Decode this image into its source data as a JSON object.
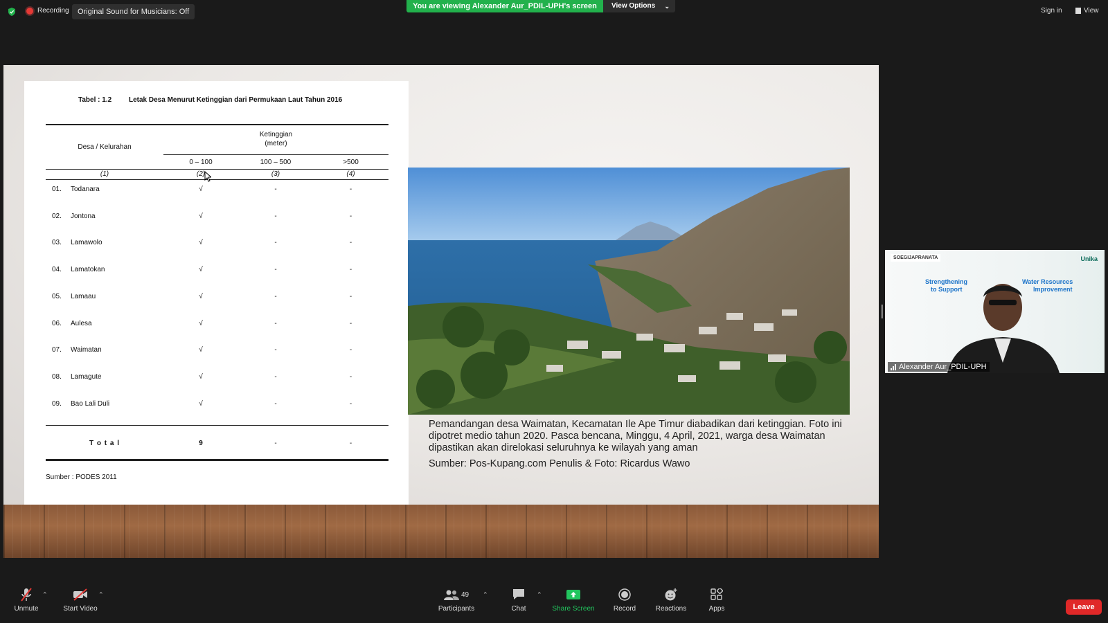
{
  "topbar": {
    "recording_label": "Recording",
    "original_sound": "Original Sound for Musicians: Off",
    "viewing_banner": "You are viewing Alexander Aur_PDIL-UPH's screen",
    "view_options": "View Options",
    "sign_in": "Sign in",
    "view": "View"
  },
  "slide": {
    "table": {
      "title_num": "Tabel :  1.2",
      "title_text": "Letak Desa Menurut Ketinggian dari Permukaan Laut Tahun 2016",
      "col_desa": "Desa / Kelurahan",
      "col_ketinggian": "Ketinggian",
      "col_meter": "(meter)",
      "sub_headers": [
        "0 – 100",
        "100 – 500",
        ">500"
      ],
      "col_numbers": [
        "(1)",
        "(2)",
        "(3)",
        "(4)"
      ],
      "rows": [
        {
          "no": "01.",
          "name": "Todanara",
          "c1": "√",
          "c2": "-",
          "c3": "-"
        },
        {
          "no": "02.",
          "name": "Jontona",
          "c1": "√",
          "c2": "-",
          "c3": "-"
        },
        {
          "no": "03.",
          "name": "Lamawolo",
          "c1": "√",
          "c2": "-",
          "c3": "-"
        },
        {
          "no": "04.",
          "name": "Lamatokan",
          "c1": "√",
          "c2": "-",
          "c3": "-"
        },
        {
          "no": "05.",
          "name": "Lamaau",
          "c1": "√",
          "c2": "-",
          "c3": "-"
        },
        {
          "no": "06.",
          "name": "Aulesa",
          "c1": "√",
          "c2": "-",
          "c3": "-"
        },
        {
          "no": "07.",
          "name": "Waimatan",
          "c1": "√",
          "c2": "-",
          "c3": "-"
        },
        {
          "no": "08.",
          "name": "Lamagute",
          "c1": "√",
          "c2": "-",
          "c3": "-"
        },
        {
          "no": "09.",
          "name": "Bao Lali Duli",
          "c1": "√",
          "c2": "-",
          "c3": "-"
        }
      ],
      "total_label": "T o t a l",
      "total_values": [
        "9",
        "-",
        "-"
      ],
      "source": "Sumber  : PODES 2011"
    },
    "caption": "Pemandangan desa Waimatan, Kecamatan Ile Ape Timur diabadikan dari ketinggian. Foto ini dipotret medio tahun 2020. Pasca bencana, Minggu, 4 April, 2021, warga desa Waimatan dipastikan akan direlokasi seluruhnya ke wilayah yang aman",
    "source_prefix": "Sumber: ",
    "source_link": "Pos-Kupang.com",
    "source_suffix": " Penulis & Foto: Ricardus Wawo"
  },
  "participant": {
    "name": "Alexander Aur_PDIL-UPH",
    "bg_logo_left": "SOEGIJAPRANATA",
    "bg_logo_right": "Unika",
    "bg_line1": "Strengthening",
    "bg_line1b": "Water Resources",
    "bg_line2": "to Support",
    "bg_line2b": "Improvement"
  },
  "toolbar": {
    "unmute": "Unmute",
    "start_video": "Start Video",
    "participants": "Participants",
    "participant_count": "49",
    "chat": "Chat",
    "share_screen": "Share Screen",
    "record": "Record",
    "reactions": "Reactions",
    "apps": "Apps",
    "leave": "Leave"
  },
  "colors": {
    "banner_green": "#22b14c",
    "share_green": "#22c55e",
    "leave_red": "#e02828",
    "recording_red": "#e53935"
  }
}
